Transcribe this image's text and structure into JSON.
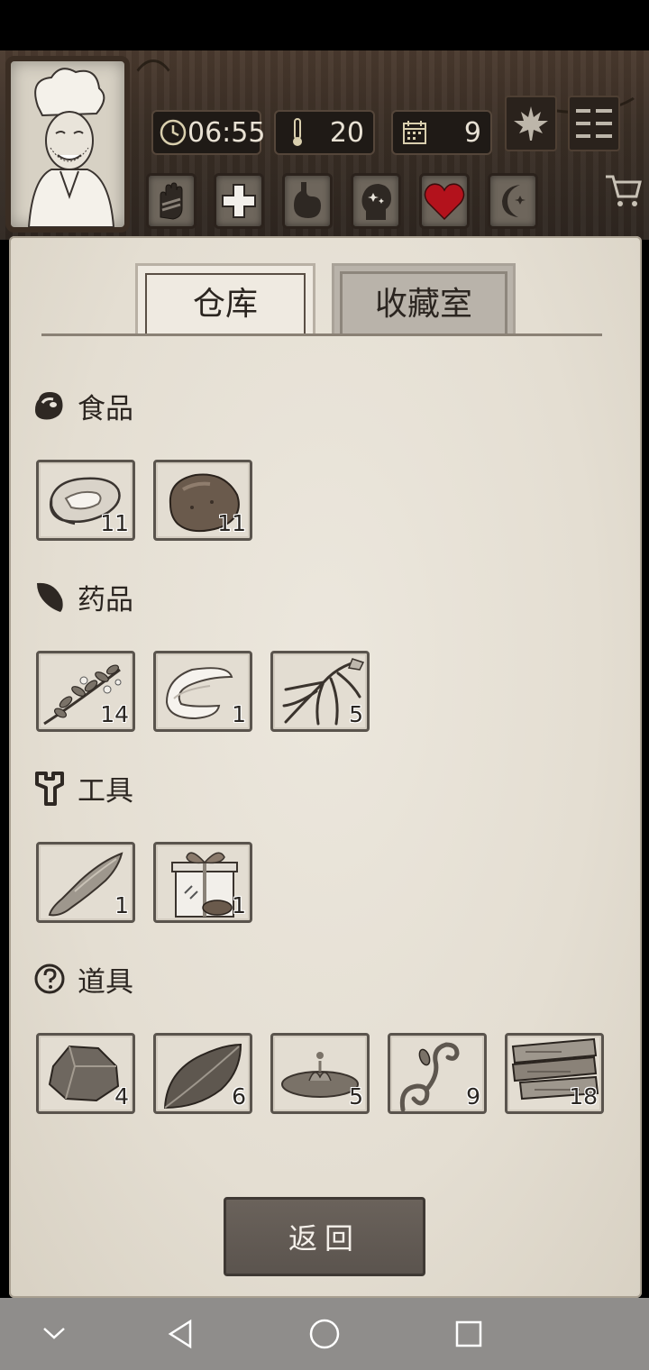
{
  "hud": {
    "time": "06:55",
    "temperature": "20",
    "day": "9"
  },
  "tabs": [
    {
      "label": "仓库",
      "active": true
    },
    {
      "label": "收藏室",
      "active": false
    }
  ],
  "sections": [
    {
      "label": "食品",
      "icon": "meat-icon",
      "items": [
        {
          "icon": "steak-icon",
          "count": "11"
        },
        {
          "icon": "potato-icon",
          "count": "11"
        }
      ]
    },
    {
      "label": "药品",
      "icon": "leaf-icon",
      "items": [
        {
          "icon": "herb-branch-icon",
          "count": "14"
        },
        {
          "icon": "bandage-icon",
          "count": "1"
        },
        {
          "icon": "ginseng-root-icon",
          "count": "5"
        }
      ]
    },
    {
      "label": "工具",
      "icon": "wrench-icon",
      "items": [
        {
          "icon": "stone-blade-icon",
          "count": "1"
        },
        {
          "icon": "gift-box-icon",
          "count": "1"
        }
      ]
    },
    {
      "label": "道具",
      "icon": "question-icon",
      "items": [
        {
          "icon": "stone-icon",
          "count": "4"
        },
        {
          "icon": "big-leaf-icon",
          "count": "6"
        },
        {
          "icon": "mud-puddle-icon",
          "count": "5"
        },
        {
          "icon": "vine-icon",
          "count": "9"
        },
        {
          "icon": "wood-planks-icon",
          "count": "18"
        }
      ]
    }
  ],
  "buttons": {
    "return_label": "返回"
  },
  "colors": {
    "heart": "#b3121c",
    "panel": "#e8e3d9",
    "wood": "#3b2f26"
  }
}
